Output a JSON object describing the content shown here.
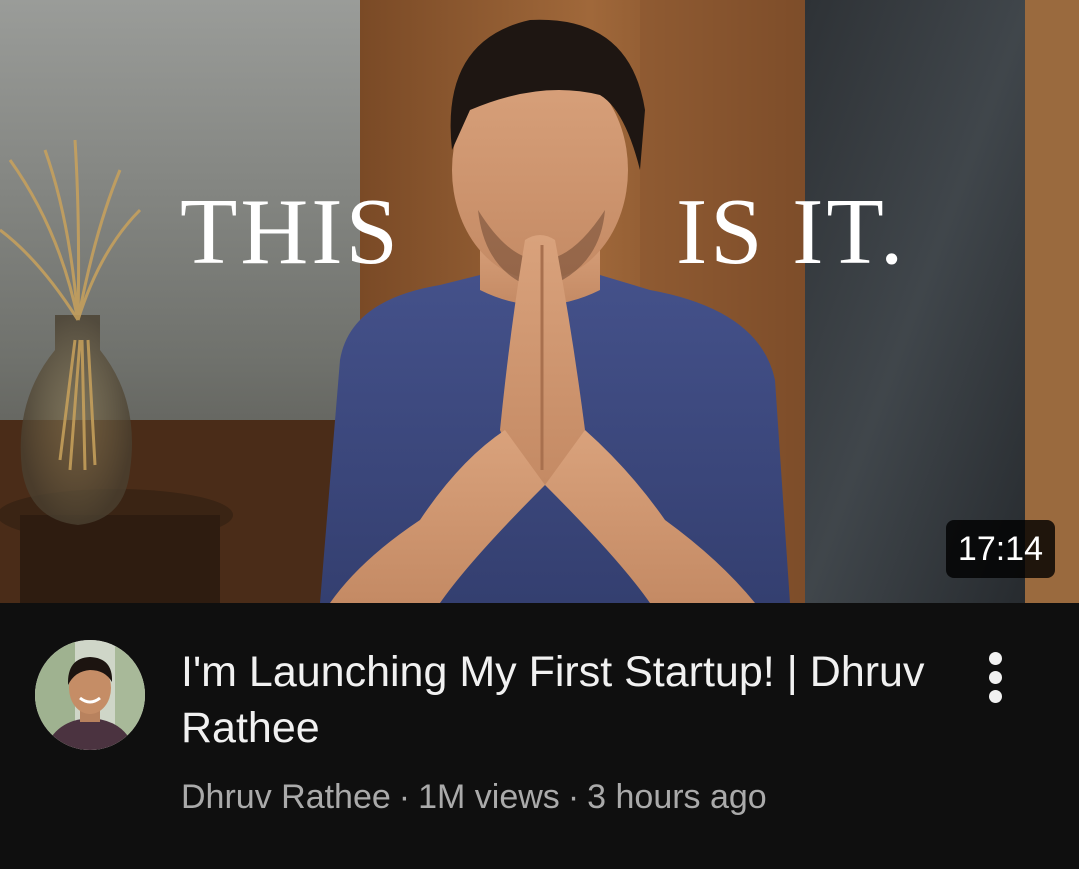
{
  "thumbnail": {
    "overlay_left": "THIS",
    "overlay_right": "IS IT.",
    "duration": "17:14"
  },
  "video": {
    "title": "I'm Launching My First Startup! | Dhruv Rathee",
    "channel": "Dhruv Rathee",
    "separator": "·",
    "views": "1M views",
    "age": "3 hours ago"
  },
  "icons": {
    "menu": "more-vert-icon"
  },
  "colors": {
    "background": "#0f0f0f",
    "title": "#f1f1f1",
    "meta": "#aaaaaa"
  }
}
